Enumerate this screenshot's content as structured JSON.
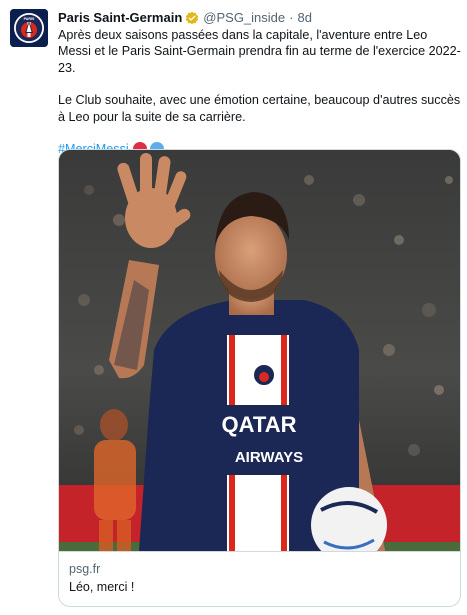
{
  "author": {
    "display_name": "Paris Saint-Germain",
    "handle": "@PSG_inside",
    "separator": "·",
    "timestamp": "8d",
    "avatar_text": "PARIS",
    "verified_color": "#e2b719"
  },
  "tweet": {
    "paragraphs": [
      "Après deux saisons passées dans la capitale, l'aventure entre Leo Messi et le Paris Saint-Germain prendra fin au terme de l'exercice 2022-23.",
      "Le Club souhaite, avec une émotion certaine, beaucoup d'autres succès à Leo pour la suite de sa carrière."
    ],
    "hashtag": "#MerciMessi",
    "heart_colors": [
      "#dd2e44",
      "#5dadec"
    ]
  },
  "link_card": {
    "domain": "psg.fr",
    "title": "Léo, merci !",
    "image_alt": "Leo Messi waving in PSG kit",
    "jersey_sponsor_line1": "QATAR",
    "jersey_sponsor_line2": "AIRWAYS"
  },
  "colors": {
    "link_blue": "#1d9bf0",
    "psg_navy": "#1b2755",
    "psg_red": "#da291c",
    "muted_text": "#536471",
    "border": "#cfd9de"
  }
}
